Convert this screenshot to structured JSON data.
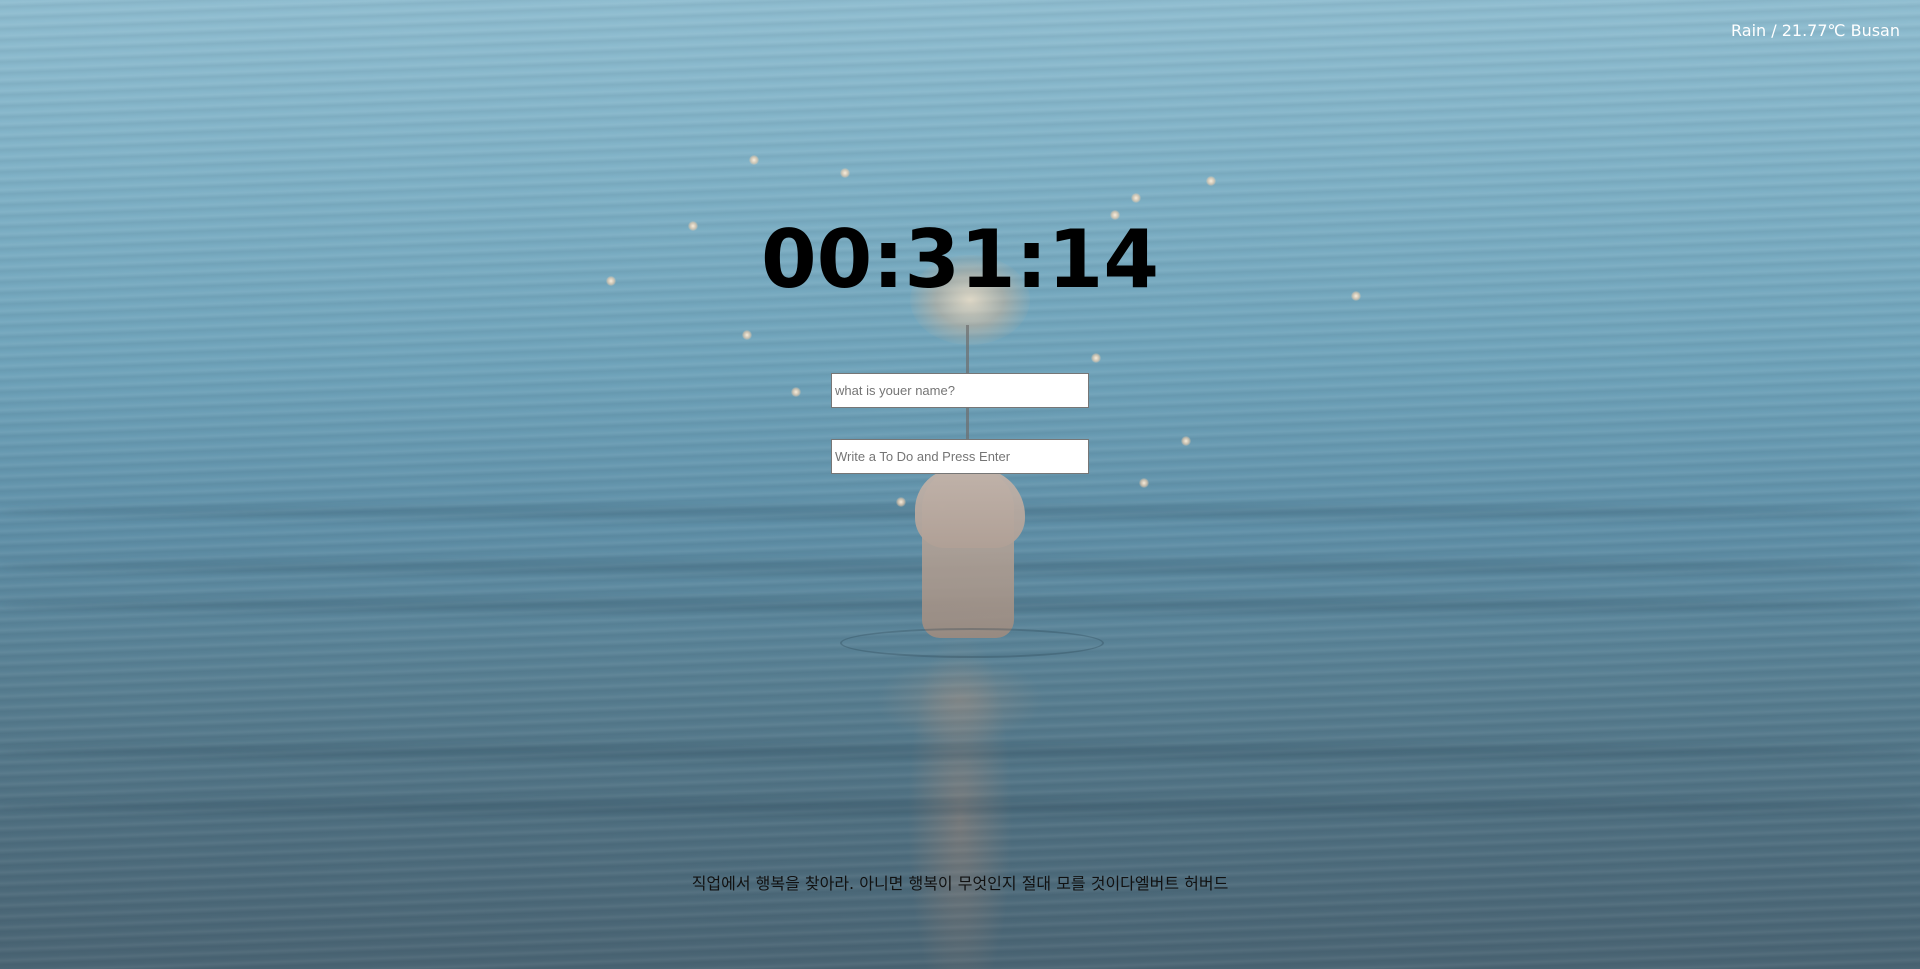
{
  "weather": {
    "text": "Rain / 21.77℃ Busan"
  },
  "clock": {
    "time": "00:31:14"
  },
  "greeting_form": {
    "placeholder": "what is youer name?"
  },
  "todo_form": {
    "placeholder": "Write a To Do and Press Enter",
    "items": []
  },
  "quote": {
    "text": "직업에서 행복을 찾아라. 아니면 행복이 무엇인지 절대 모를 것이다",
    "author": "엘버트 허버드"
  }
}
